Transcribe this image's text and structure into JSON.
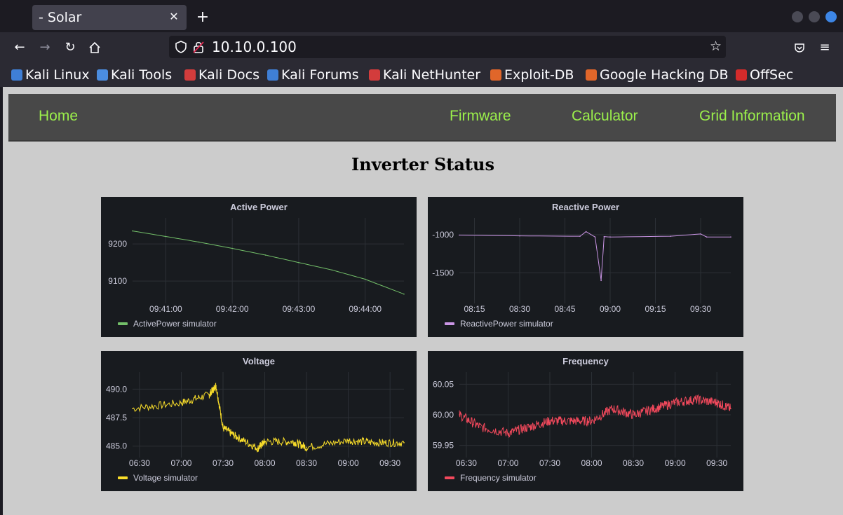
{
  "browser": {
    "tab_title": "- Solar",
    "new_tab_symbol": "+",
    "url": "10.10.0.100",
    "bookmarks": [
      {
        "label": "Kali Linux",
        "color": "#3f7fd6"
      },
      {
        "label": "Kali Tools",
        "color": "#4b8de0"
      },
      {
        "label": "Kali Docs",
        "color": "#d33c3c"
      },
      {
        "label": "Kali Forums",
        "color": "#3f7fd6"
      },
      {
        "label": "Kali NetHunter",
        "color": "#d33c3c"
      },
      {
        "label": "Exploit-DB",
        "color": "#e0662a"
      },
      {
        "label": "Google Hacking DB",
        "color": "#e0662a"
      },
      {
        "label": "OffSec",
        "color": "#d42b2b"
      }
    ]
  },
  "site": {
    "nav": {
      "home": "Home",
      "firmware": "Firmware",
      "calculator": "Calculator",
      "grid_information": "Grid Information"
    },
    "heading": "Inverter Status"
  },
  "colors": {
    "nav_link": "#9bf04b",
    "panel_bg": "#181b1f",
    "active_power": "#73bf69",
    "reactive_power": "#ca95e5",
    "voltage": "#fade2a",
    "frequency": "#f2495c"
  },
  "chart_data": [
    {
      "type": "line",
      "title": "Active Power",
      "series": [
        {
          "name": "ActivePower simulator",
          "color": "#73bf69"
        }
      ],
      "x": [
        "09:40:30",
        "09:41:00",
        "09:41:30",
        "09:42:00",
        "09:42:30",
        "09:43:00",
        "09:43:30",
        "09:44:00",
        "09:44:35"
      ],
      "y": [
        9235,
        9220,
        9205,
        9188,
        9170,
        9150,
        9130,
        9105,
        9065
      ],
      "x_ticks": [
        "09:41:00",
        "09:42:00",
        "09:43:00",
        "09:44:00"
      ],
      "y_ticks": [
        "9200",
        "9100"
      ],
      "ylim": [
        9040,
        9270
      ],
      "grid": true,
      "legend": "bottom-left"
    },
    {
      "type": "line",
      "title": "Reactive Power",
      "series": [
        {
          "name": "ReactivePower simulator",
          "color": "#ca95e5"
        }
      ],
      "x": [
        "08:10",
        "08:30",
        "08:50",
        "08:52",
        "08:55",
        "08:57",
        "08:58",
        "09:00",
        "09:20",
        "09:30",
        "09:32",
        "09:40"
      ],
      "y": [
        -1005,
        -1015,
        -1020,
        -960,
        -1030,
        -1600,
        -1025,
        -1030,
        -1020,
        -990,
        -1030,
        -1030
      ],
      "x_ticks": [
        "08:15",
        "08:30",
        "08:45",
        "09:00",
        "09:15",
        "09:30"
      ],
      "y_ticks": [
        "-1000",
        "-1500"
      ],
      "ylim": [
        -1900,
        -780
      ],
      "grid": true,
      "legend": "bottom-left"
    },
    {
      "type": "line",
      "title": "Voltage",
      "series": [
        {
          "name": "Voltage simulator",
          "color": "#fade2a"
        }
      ],
      "x": [
        "06:25",
        "07:00",
        "07:20",
        "07:25",
        "07:30",
        "07:40",
        "07:55",
        "08:00",
        "08:20",
        "08:30",
        "09:00",
        "09:20",
        "09:40"
      ],
      "y": [
        488.3,
        488.8,
        489.5,
        490.3,
        486.6,
        485.8,
        484.8,
        485.4,
        485.4,
        484.9,
        485.5,
        485.3,
        485.3
      ],
      "x_ticks": [
        "06:30",
        "07:00",
        "07:30",
        "08:00",
        "08:30",
        "09:00",
        "09:30"
      ],
      "y_ticks": [
        "490.0",
        "487.5",
        "485.0"
      ],
      "ylim": [
        484.0,
        491.5
      ],
      "grid": true,
      "legend": "bottom-left"
    },
    {
      "type": "line",
      "title": "Frequency",
      "series": [
        {
          "name": "Frequency simulator",
          "color": "#f2495c"
        }
      ],
      "x": [
        "06:25",
        "06:40",
        "07:00",
        "07:15",
        "07:30",
        "07:45",
        "08:00",
        "08:15",
        "08:30",
        "08:45",
        "09:00",
        "09:15",
        "09:30",
        "09:40"
      ],
      "y": [
        60.0,
        59.98,
        59.97,
        59.98,
        59.99,
        59.99,
        59.99,
        60.01,
        60.0,
        60.01,
        60.02,
        60.025,
        60.02,
        60.01
      ],
      "x_ticks": [
        "06:30",
        "07:00",
        "07:30",
        "08:00",
        "08:30",
        "09:00",
        "09:30"
      ],
      "y_ticks": [
        "60.05",
        "60.00",
        "59.95"
      ],
      "ylim": [
        59.93,
        60.07
      ],
      "grid": true,
      "legend": "bottom-left"
    }
  ]
}
